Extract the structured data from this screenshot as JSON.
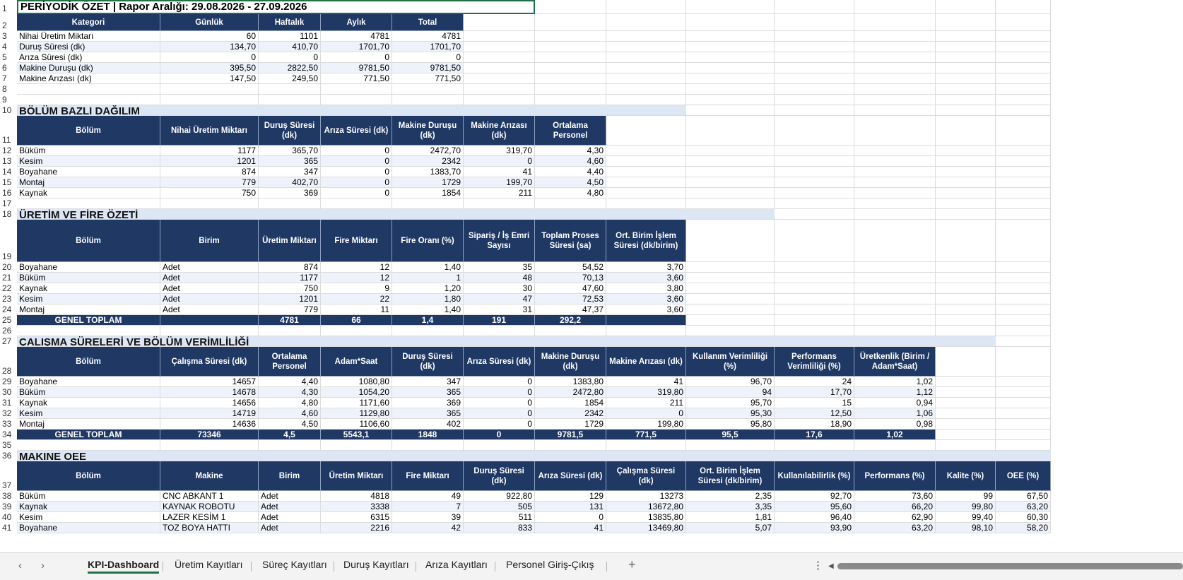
{
  "title": "PERİYODİK ÖZET   |   Rapor Aralığı: 29.08.2026 - 27.09.2026",
  "summary": {
    "headers": [
      "Kategori",
      "Günlük",
      "Haftalık",
      "Aylık",
      "Total"
    ],
    "rows": [
      [
        "Nihai Üretim Miktarı",
        "60",
        "1101",
        "4781",
        "4781"
      ],
      [
        "Duruş Süresi (dk)",
        "134,70",
        "410,70",
        "1701,70",
        "1701,70"
      ],
      [
        "Arıza Süresi (dk)",
        "0",
        "0",
        "0",
        "0"
      ],
      [
        "Makine Duruşu (dk)",
        "395,50",
        "2822,50",
        "9781,50",
        "9781,50"
      ],
      [
        "Makine Arızası (dk)",
        "147,50",
        "249,50",
        "771,50",
        "771,50"
      ]
    ]
  },
  "dept_section": {
    "title": "BÖLÜM BAZLI DAĞILIM",
    "headers": [
      "Bölüm",
      "Nihai Üretim Miktarı",
      "Duruş Süresi (dk)",
      "Arıza Süresi (dk)",
      "Makine Duruşu (dk)",
      "Makine Arızası (dk)",
      "Ortalama Personel"
    ],
    "rows": [
      [
        "Büküm",
        "1177",
        "365,70",
        "0",
        "2472,70",
        "319,70",
        "4,30"
      ],
      [
        "Kesim",
        "1201",
        "365",
        "0",
        "2342",
        "0",
        "4,60"
      ],
      [
        "Boyahane",
        "874",
        "347",
        "0",
        "1383,70",
        "41",
        "4,40"
      ],
      [
        "Montaj",
        "779",
        "402,70",
        "0",
        "1729",
        "199,70",
        "4,50"
      ],
      [
        "Kaynak",
        "750",
        "369",
        "0",
        "1854",
        "211",
        "4,80"
      ]
    ]
  },
  "prod_section": {
    "title": "ÜRETİM VE FİRE ÖZETİ",
    "headers": [
      "Bölüm",
      "Birim",
      "Üretim Miktarı",
      "Fire Miktarı",
      "Fire Oranı (%)",
      "Sipariş / İş Emri Sayısı",
      "Toplam Proses Süresi (sa)",
      "Ort. Birim İşlem Süresi (dk/birim)"
    ],
    "rows": [
      [
        "Boyahane",
        "Adet",
        "874",
        "12",
        "1,40",
        "35",
        "54,52",
        "3,70"
      ],
      [
        "Büküm",
        "Adet",
        "1177",
        "12",
        "1",
        "48",
        "70,13",
        "3,60"
      ],
      [
        "Kaynak",
        "Adet",
        "750",
        "9",
        "1,20",
        "30",
        "47,60",
        "3,80"
      ],
      [
        "Kesim",
        "Adet",
        "1201",
        "22",
        "1,80",
        "47",
        "72,53",
        "3,60"
      ],
      [
        "Montaj",
        "Adet",
        "779",
        "11",
        "1,40",
        "31",
        "47,37",
        "3,60"
      ]
    ],
    "total": [
      "GENEL TOPLAM",
      "",
      "4781",
      "66",
      "1,4",
      "191",
      "292,2",
      ""
    ]
  },
  "work_section": {
    "title": "ÇALIŞMA SÜRELERİ VE BÖLÜM VERİMLİLİĞİ",
    "headers": [
      "Bölüm",
      "Çalışma Süresi (dk)",
      "Ortalama Personel",
      "Adam*Saat",
      "Duruş Süresi (dk)",
      "Arıza Süresi (dk)",
      "Makine Duruşu (dk)",
      "Makine Arızası (dk)",
      "Kullanım Verimliliği (%)",
      "Performans Verimliliği (%)",
      "Üretkenlik (Birim / Adam*Saat)"
    ],
    "rows": [
      [
        "Boyahane",
        "14657",
        "4,40",
        "1080,80",
        "347",
        "0",
        "1383,80",
        "41",
        "96,70",
        "24",
        "1,02"
      ],
      [
        "Büküm",
        "14678",
        "4,30",
        "1054,20",
        "365",
        "0",
        "2472,80",
        "319,80",
        "94",
        "17,70",
        "1,12"
      ],
      [
        "Kaynak",
        "14656",
        "4,80",
        "1171,60",
        "369",
        "0",
        "1854",
        "211",
        "95,70",
        "15",
        "0,94"
      ],
      [
        "Kesim",
        "14719",
        "4,60",
        "1129,80",
        "365",
        "0",
        "2342",
        "0",
        "95,30",
        "12,50",
        "1,06"
      ],
      [
        "Montaj",
        "14636",
        "4,50",
        "1106,60",
        "402",
        "0",
        "1729",
        "199,80",
        "95,80",
        "18,90",
        "0,98"
      ]
    ],
    "total": [
      "GENEL TOPLAM",
      "73346",
      "4,5",
      "5543,1",
      "1848",
      "0",
      "9781,5",
      "771,5",
      "95,5",
      "17,6",
      "1,02"
    ]
  },
  "oee_section": {
    "title": "MAKINE OEE",
    "headers": [
      "Bölüm",
      "Makine",
      "Birim",
      "Üretim Miktarı",
      "Fire Miktarı",
      "Duruş Süresi (dk)",
      "Arıza Süresi (dk)",
      "Çalışma Süresi (dk)",
      "Ort. Birim İşlem Süresi (dk/birim)",
      "Kullanılabilirlik (%)",
      "Performans (%)",
      "Kalite (%)",
      "OEE (%)"
    ],
    "rows": [
      [
        "Büküm",
        "CNC ABKANT 1",
        "Adet",
        "4818",
        "49",
        "922,80",
        "129",
        "13273",
        "2,35",
        "92,70",
        "73,60",
        "99",
        "67,50"
      ],
      [
        "Kaynak",
        "KAYNAK ROBOTU",
        "Adet",
        "3338",
        "7",
        "505",
        "131",
        "13672,80",
        "3,35",
        "95,60",
        "66,20",
        "99,80",
        "63,20"
      ],
      [
        "Kesim",
        "LAZER KESİM 1",
        "Adet",
        "6315",
        "39",
        "511",
        "0",
        "13835,80",
        "1,81",
        "96,40",
        "62,90",
        "99,40",
        "60,30"
      ],
      [
        "Boyahane",
        "TOZ BOYA HATTI",
        "Adet",
        "2216",
        "42",
        "833",
        "41",
        "13469,80",
        "5,07",
        "93,90",
        "63,20",
        "98,10",
        "58,20"
      ]
    ]
  },
  "tabs": [
    "KPI-Dashboard",
    "Üretim Kayıtları",
    "Süreç Kayıtları",
    "Duruş Kayıtları",
    "Arıza Kayıtları",
    "Personel Giriş-Çıkış"
  ],
  "row_numbers": [
    "1",
    "2",
    "3",
    "4",
    "5",
    "6",
    "7",
    "8",
    "9",
    "10",
    "11",
    "12",
    "13",
    "14",
    "15",
    "16",
    "17",
    "18",
    "19",
    "20",
    "21",
    "22",
    "23",
    "24",
    "25",
    "26",
    "27",
    "28",
    "29",
    "30",
    "31",
    "32",
    "33",
    "34",
    "35",
    "36",
    "37",
    "38",
    "39",
    "40",
    "41"
  ],
  "icons": {
    "prev": "chevron-left-icon",
    "next": "chevron-right-icon",
    "add": "plus-icon",
    "more": "more-vertical-icon"
  }
}
